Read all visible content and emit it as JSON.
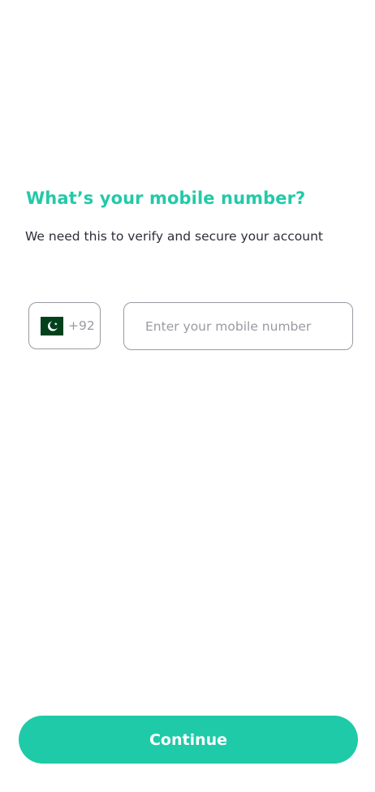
{
  "heading": {
    "title": "What’s your mobile number?",
    "subtitle": "We need this to verify and secure your account"
  },
  "phone": {
    "country_flag": "pakistan-flag-icon",
    "dial_code": "+92",
    "number_value": "",
    "number_placeholder": "Enter your mobile number"
  },
  "actions": {
    "continue_label": "Continue"
  },
  "colors": {
    "accent": "#1fcaa8",
    "title": "#23c9a8",
    "text": "#2e2e3a",
    "muted": "#9a9aa2",
    "flag_green": "#01411c"
  }
}
